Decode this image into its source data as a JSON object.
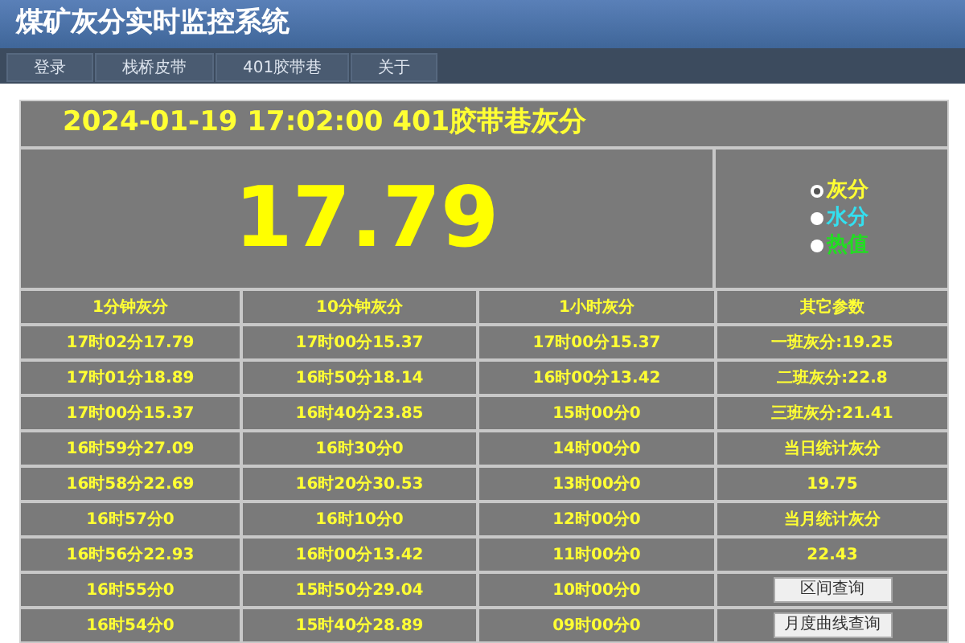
{
  "window": {
    "title": "煤矿灰分实时监控系统"
  },
  "nav": [
    {
      "label": "登录"
    },
    {
      "label": "栈桥皮带"
    },
    {
      "label": "401胶带巷"
    },
    {
      "label": "关于"
    }
  ],
  "panel": {
    "title": "2024-01-19 17:02:00 401胶带巷灰分",
    "reading": "17.79",
    "options": [
      {
        "label": "灰分",
        "selected": true,
        "color": "#ffff33"
      },
      {
        "label": "水分",
        "selected": false,
        "color": "#33e0f0"
      },
      {
        "label": "热值",
        "selected": false,
        "color": "#22dd22"
      }
    ]
  },
  "table": {
    "columns": [
      "1分钟灰分",
      "10分钟灰分",
      "1小时灰分",
      "其它参数"
    ],
    "rows": [
      {
        "cells": [
          "17时02分17.79",
          "17时00分15.37",
          "17时00分15.37"
        ],
        "other": {
          "kind": "text",
          "text": "一班灰分:19.25"
        }
      },
      {
        "cells": [
          "17时01分18.89",
          "16时50分18.14",
          "16时00分13.42"
        ],
        "other": {
          "kind": "text",
          "text": "二班灰分:22.8"
        }
      },
      {
        "cells": [
          "17时00分15.37",
          "16时40分23.85",
          "15时00分0"
        ],
        "other": {
          "kind": "text",
          "text": "三班灰分:21.41"
        }
      },
      {
        "cells": [
          "16时59分27.09",
          "16时30分0",
          "14时00分0"
        ],
        "other": {
          "kind": "text",
          "text": "当日统计灰分"
        }
      },
      {
        "cells": [
          "16时58分22.69",
          "16时20分30.53",
          "13时00分0"
        ],
        "other": {
          "kind": "text",
          "text": "19.75"
        }
      },
      {
        "cells": [
          "16时57分0",
          "16时10分0",
          "12时00分0"
        ],
        "other": {
          "kind": "text",
          "text": "当月统计灰分"
        }
      },
      {
        "cells": [
          "16时56分22.93",
          "16时00分13.42",
          "11时00分0"
        ],
        "other": {
          "kind": "text",
          "text": "22.43"
        }
      },
      {
        "cells": [
          "16时55分0",
          "15时50分29.04",
          "10时00分0"
        ],
        "other": {
          "kind": "button",
          "text": "区间查询"
        }
      },
      {
        "cells": [
          "16时54分0",
          "15时40分28.89",
          "09时00分0"
        ],
        "other": {
          "kind": "button",
          "text": "月度曲线查询"
        }
      }
    ]
  }
}
